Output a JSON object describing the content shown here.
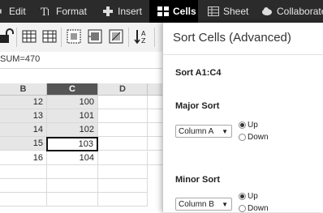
{
  "menubar": {
    "items": [
      {
        "label": "Edit",
        "icon": "pencil-icon"
      },
      {
        "label": "Format",
        "icon": "text-format-icon"
      },
      {
        "label": "Insert",
        "icon": "plus-icon"
      },
      {
        "label": "Cells",
        "icon": "grid-icon",
        "active": true
      },
      {
        "label": "Sheet",
        "icon": "sheet-icon"
      },
      {
        "label": "Collaborate",
        "icon": "cloud-icon"
      }
    ]
  },
  "toolbar": {
    "icons": [
      "lock-icon",
      "insert-column-icon",
      "delete-column-icon",
      "border-cell-icon",
      "merge-cells-icon",
      "format-cell-icon",
      "sort-az-icon"
    ]
  },
  "formula": {
    "text": "SUM=470"
  },
  "grid": {
    "columns": [
      "B",
      "C",
      "D"
    ],
    "selected_column": "C",
    "rows": [
      {
        "b": "12",
        "c": "100"
      },
      {
        "b": "13",
        "c": "101"
      },
      {
        "b": "14",
        "c": "102"
      },
      {
        "b": "15",
        "c": "103"
      },
      {
        "b": "16",
        "c": "104"
      }
    ]
  },
  "dialog": {
    "title": "Sort Cells (Advanced)",
    "range_label": "Sort A1:C4",
    "major": {
      "label": "Major Sort",
      "select": "Column A",
      "up": "Up",
      "down": "Down",
      "selected": "Up"
    },
    "minor": {
      "label": "Minor Sort",
      "select": "Column B",
      "up": "Up",
      "down": "Down",
      "selected": "Up"
    }
  }
}
